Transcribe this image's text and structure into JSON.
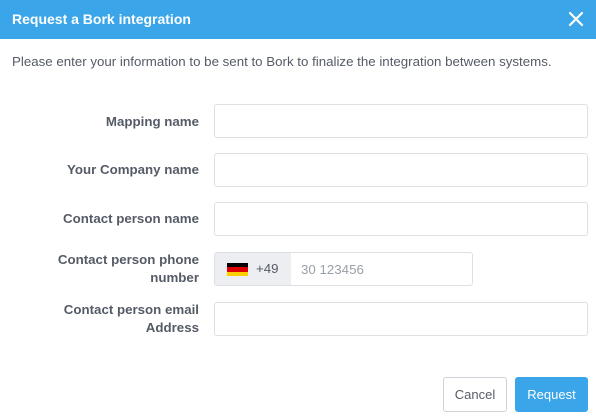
{
  "dialog": {
    "title": "Request a Bork integration",
    "close_icon": "close-icon",
    "intro": "Please enter your information to be sent to Bork to finalize the integration between systems."
  },
  "form": {
    "mapping_name_label": "Mapping name",
    "mapping_name_value": "",
    "company_name_label": "Your Company name",
    "company_name_value": "",
    "contact_name_label": "Contact person name",
    "contact_name_value": "",
    "phone_label_line1": "Contact person phone",
    "phone_label_line2": "number",
    "phone_country_icon": "germany-flag-icon",
    "phone_dial_code": "+49",
    "phone_placeholder": "30 123456",
    "phone_value": "",
    "email_label_line1": "Contact person email",
    "email_label_line2": "Address",
    "email_value": ""
  },
  "actions": {
    "cancel_label": "Cancel",
    "request_label": "Request"
  },
  "colors": {
    "accent": "#3aa6e9",
    "text": "#555b66",
    "border": "#dde1e6",
    "prefix_bg": "#eceef1"
  }
}
